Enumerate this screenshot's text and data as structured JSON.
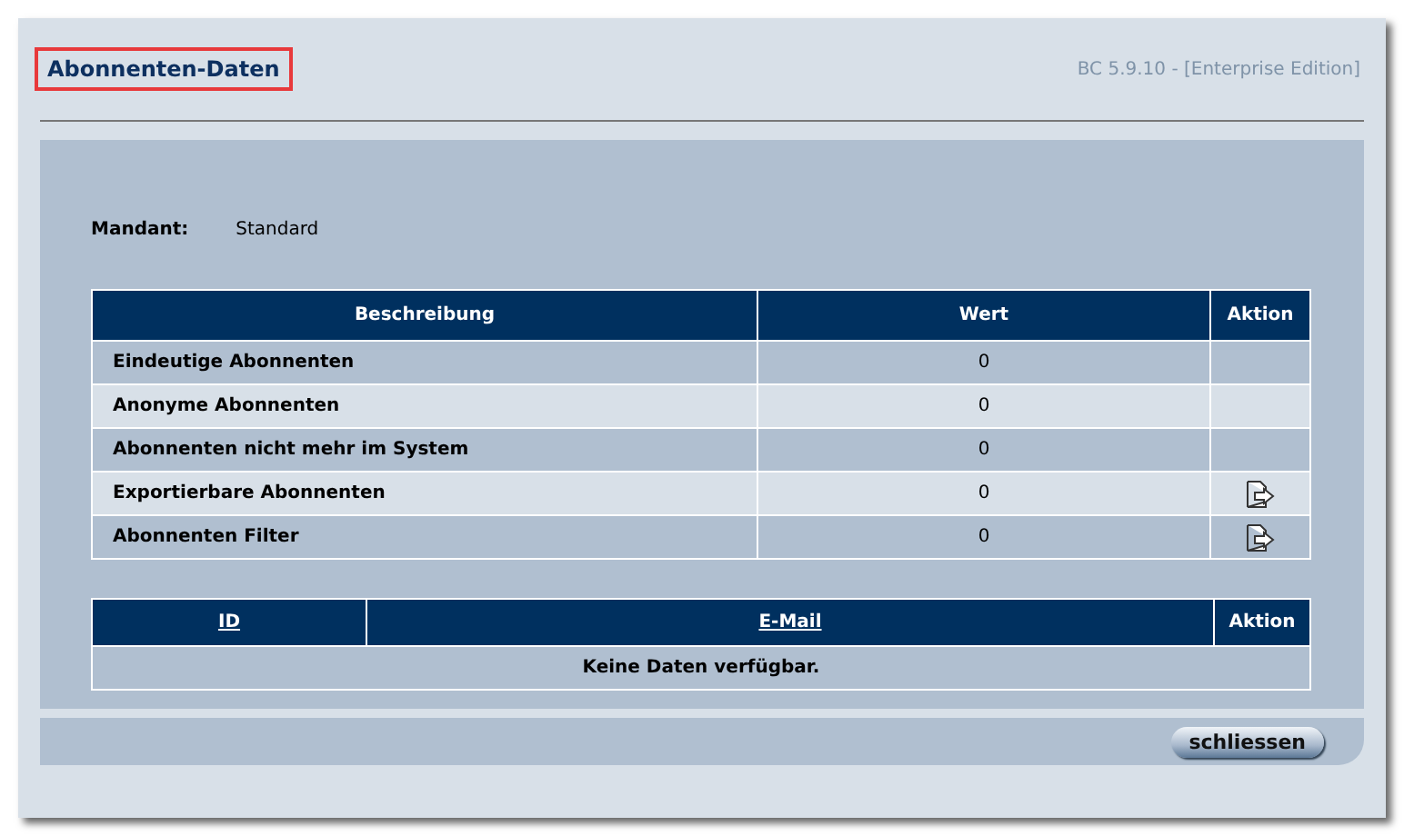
{
  "window": {
    "title": "Abonnenten-Daten",
    "version": "BC 5.9.10 - [Enterprise Edition]"
  },
  "mandant": {
    "label": "Mandant:",
    "value": "Standard"
  },
  "stats_table": {
    "columns": [
      {
        "label": "Beschreibung",
        "link": false
      },
      {
        "label": "Wert",
        "link": false
      },
      {
        "label": "Aktion",
        "link": false
      }
    ],
    "rows": [
      {
        "label": "Eindeutige Abonnenten",
        "value": "0",
        "export": false
      },
      {
        "label": "Anonyme Abonnenten",
        "value": "0",
        "export": false
      },
      {
        "label": "Abonnenten nicht mehr im System",
        "value": "0",
        "export": false
      },
      {
        "label": "Exportierbare Abonnenten",
        "value": "0",
        "export": true
      },
      {
        "label": "Abonnenten Filter",
        "value": "0",
        "export": true
      }
    ]
  },
  "list_table": {
    "columns": [
      {
        "label": "ID",
        "link": true
      },
      {
        "label": "E-Mail",
        "link": true
      },
      {
        "label": "Aktion",
        "link": false
      }
    ],
    "empty_message": "Keine Daten verfügbar."
  },
  "buttons": [
    "schliessen"
  ]
}
